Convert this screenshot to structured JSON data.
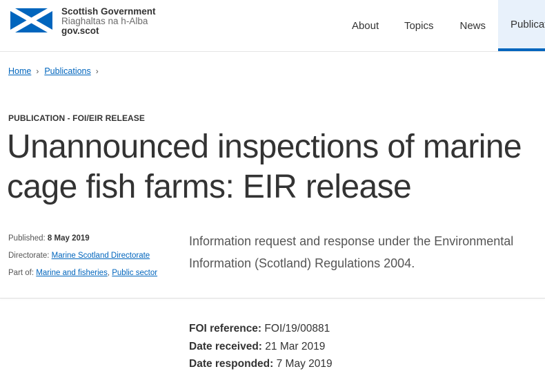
{
  "header": {
    "logo": {
      "line1": "Scottish Government",
      "line2": "Riaghaltas na h-Alba",
      "line3": "gov.scot"
    },
    "nav": [
      {
        "label": "About"
      },
      {
        "label": "Topics"
      },
      {
        "label": "News"
      },
      {
        "label": "Publications",
        "active": true
      }
    ]
  },
  "breadcrumb": {
    "items": [
      "Home",
      "Publications"
    ],
    "separator": "›"
  },
  "publication": {
    "type_label": "PUBLICATION - FOI/EIR RELEASE",
    "title": "Unannounced inspections of marine cage fish farms: EIR release"
  },
  "metadata": {
    "published_label": "Published: ",
    "published_value": "8 May 2019",
    "directorate_label": "Directorate: ",
    "directorate_value": "Marine Scotland Directorate",
    "partof_label": "Part of: ",
    "partof_items": [
      "Marine and fisheries",
      "Public sector"
    ],
    "partof_separator": ", "
  },
  "summary": "Information request and response under the Environmental Information (Scotland) Regulations 2004.",
  "foi": {
    "reference_label": "FOI reference:",
    "reference_value": " FOI/19/00881",
    "received_label": "Date received:",
    "received_value": " 21 Mar 2019",
    "responded_label": "Date responded:",
    "responded_value": " 7 May 2019"
  },
  "colors": {
    "accent": "#0065bd",
    "flag_blue": "#0065bd",
    "nav_active_bg": "#e8f1fb",
    "text": "#333333"
  },
  "icons": {
    "logo": "saltire-flag-icon",
    "breadcrumb_separator": "chevron-right-icon"
  }
}
